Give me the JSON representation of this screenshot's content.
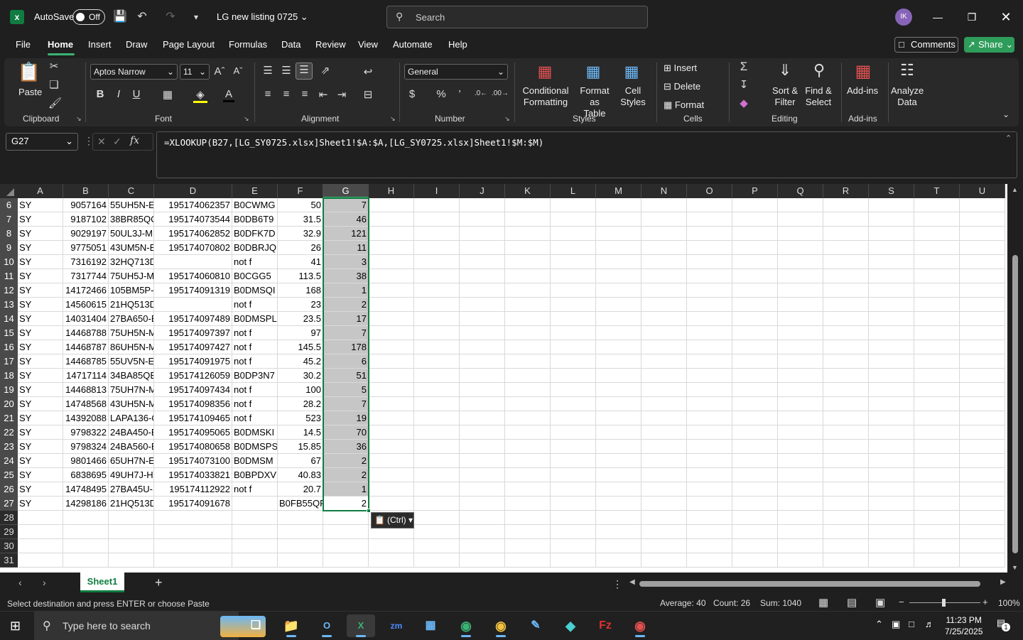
{
  "titlebar": {
    "autosave_label": "AutoSave",
    "autosave_state": "Off",
    "doc_title": "LG new listing 0725",
    "search_placeholder": "Search",
    "avatar_initials": "IK"
  },
  "menu": {
    "items": [
      "File",
      "Home",
      "Insert",
      "Draw",
      "Page Layout",
      "Formulas",
      "Data",
      "Review",
      "View",
      "Automate",
      "Help"
    ],
    "active": "Home",
    "comments_label": "Comments",
    "share_label": "Share"
  },
  "ribbon": {
    "paste_label": "Paste",
    "clipboard_label": "Clipboard",
    "font_name": "Aptos Narrow",
    "font_size": "11",
    "font_label": "Font",
    "alignment_label": "Alignment",
    "number_format": "General",
    "number_label": "Number",
    "conditional_formatting": [
      "Conditional",
      "Formatting"
    ],
    "format_as_table": [
      "Format as",
      "Table"
    ],
    "cell_styles": [
      "Cell",
      "Styles"
    ],
    "styles_label": "Styles",
    "insert_label": "Insert",
    "delete_label": "Delete",
    "format_label": "Format",
    "cells_label": "Cells",
    "sort_filter": [
      "Sort &",
      "Filter"
    ],
    "find_select": [
      "Find &",
      "Select"
    ],
    "editing_label": "Editing",
    "addins_label": "Add-ins",
    "addins_group_label": "Add-ins",
    "analyze_data": [
      "Analyze",
      "Data"
    ]
  },
  "formula_bar": {
    "name_box": "G27",
    "formula": "=XLOOKUP(B27,[LG_SY0725.xlsx]Sheet1!$A:$A,[LG_SY0725.xlsx]Sheet1!$M:$M)"
  },
  "grid": {
    "columns": [
      "A",
      "B",
      "C",
      "D",
      "E",
      "F",
      "G",
      "H",
      "I",
      "J",
      "K",
      "L",
      "M",
      "N",
      "O",
      "P",
      "Q",
      "R",
      "S",
      "T",
      "U"
    ],
    "selected_column": "G",
    "rows": [
      {
        "n": "6",
        "A": "SY",
        "B": "9057164",
        "C": "55UH5N-E",
        "D": "195174062357",
        "E": "B0CWMG",
        "F": "50",
        "G": "7"
      },
      {
        "n": "7",
        "A": "SY",
        "B": "9187102",
        "C": "38BR85QC",
        "D": "195174073544",
        "E": "B0DB6T9",
        "F": "31.5",
        "G": "46"
      },
      {
        "n": "8",
        "A": "SY",
        "B": "9029197",
        "C": "50UL3J-M",
        "D": "195174062852",
        "E": "B0DFK7D",
        "F": "32.9",
        "G": "121"
      },
      {
        "n": "9",
        "A": "SY",
        "B": "9775051",
        "C": "43UM5N-E",
        "D": "195174070802",
        "E": "B0DBRJQ",
        "F": "26",
        "G": "11"
      },
      {
        "n": "10",
        "A": "SY",
        "B": "7316192",
        "C": "32HQ713D",
        "D": "",
        "E": "not f",
        "F": "41",
        "G": "3"
      },
      {
        "n": "11",
        "A": "SY",
        "B": "7317744",
        "C": "75UH5J-M",
        "D": "195174060810",
        "E": "B0CGG5",
        "F": "113.5",
        "G": "38"
      },
      {
        "n": "12",
        "A": "SY",
        "B": "14172466",
        "C": "105BM5P-",
        "D": "195174091319",
        "E": "B0DMSQI",
        "F": "168",
        "G": "1"
      },
      {
        "n": "13",
        "A": "SY",
        "B": "14560615",
        "C": "21HQ513D",
        "D": "",
        "E": "not f",
        "F": "23",
        "G": "2"
      },
      {
        "n": "14",
        "A": "SY",
        "B": "14031404",
        "C": "27BA650-E",
        "D": "195174097489",
        "E": "B0DMSPL",
        "F": "23.5",
        "G": "17"
      },
      {
        "n": "15",
        "A": "SY",
        "B": "14468788",
        "C": "75UH5N-M",
        "D": "195174097397",
        "E": "not f",
        "F": "97",
        "G": "7"
      },
      {
        "n": "16",
        "A": "SY",
        "B": "14468787",
        "C": "86UH5N-M",
        "D": "195174097427",
        "E": "not f",
        "F": "145.5",
        "G": "178"
      },
      {
        "n": "17",
        "A": "SY",
        "B": "14468785",
        "C": "55UV5N-E",
        "D": "195174091975",
        "E": "not f",
        "F": "45.2",
        "G": "6"
      },
      {
        "n": "18",
        "A": "SY",
        "B": "14717114",
        "C": "34BA85QE",
        "D": "195174126059",
        "E": "B0DP3N7",
        "F": "30.2",
        "G": "51"
      },
      {
        "n": "19",
        "A": "SY",
        "B": "14468813",
        "C": "75UH7N-M",
        "D": "195174097434",
        "E": "not f",
        "F": "100",
        "G": "5"
      },
      {
        "n": "20",
        "A": "SY",
        "B": "14748568",
        "C": "43UH5N-M",
        "D": "195174098356",
        "E": "not f",
        "F": "28.2",
        "G": "7"
      },
      {
        "n": "21",
        "A": "SY",
        "B": "14392088",
        "C": "LAPA136-C",
        "D": "195174109465",
        "E": "not f",
        "F": "523",
        "G": "19"
      },
      {
        "n": "22",
        "A": "SY",
        "B": "9798322",
        "C": "24BA450-E",
        "D": "195174095065",
        "E": "B0DMSKI",
        "F": "14.5",
        "G": "70"
      },
      {
        "n": "23",
        "A": "SY",
        "B": "9798324",
        "C": "24BA560-E",
        "D": "195174080658",
        "E": "B0DMSPS",
        "F": "15.85",
        "G": "36"
      },
      {
        "n": "24",
        "A": "SY",
        "B": "9801466",
        "C": "65UH7N-E",
        "D": "195174073100",
        "E": "B0DMSM",
        "F": "67",
        "G": "2"
      },
      {
        "n": "25",
        "A": "SY",
        "B": "6838695",
        "C": "49UH7J-H",
        "D": "195174033821",
        "E": "B0BPDXV",
        "F": "40.83",
        "G": "2"
      },
      {
        "n": "26",
        "A": "SY",
        "B": "14748495",
        "C": "27BA45U-E",
        "D": "195174112922",
        "E": "not f",
        "F": "20.7",
        "G": "1"
      },
      {
        "n": "27",
        "A": "SY",
        "B": "14298186",
        "C": "21HQ513D",
        "D": "195174091678",
        "E": "",
        "F": "B0FB55QF",
        "G": "2"
      },
      {
        "n": "28",
        "A": "",
        "B": "",
        "C": "",
        "D": "",
        "E": "",
        "F": "",
        "G": ""
      },
      {
        "n": "29",
        "A": "",
        "B": "",
        "C": "",
        "D": "",
        "E": "",
        "F": "",
        "G": ""
      },
      {
        "n": "30",
        "A": "",
        "B": "",
        "C": "",
        "D": "",
        "E": "",
        "F": "",
        "G": ""
      },
      {
        "n": "31",
        "A": "",
        "B": "",
        "C": "",
        "D": "",
        "E": "",
        "F": "",
        "G": ""
      }
    ],
    "paste_tag": "(Ctrl)"
  },
  "sheet_tabs": {
    "sheets": [
      "Sheet1"
    ]
  },
  "statusbar": {
    "message": "Select destination and press ENTER or choose Paste",
    "average": "Average: 40",
    "count": "Count: 26",
    "sum": "Sum: 1040",
    "zoom": "100%"
  },
  "taskbar": {
    "search_placeholder": "Type here to search",
    "time": "11:23 PM",
    "date": "7/25/2025",
    "notification_count": "1"
  },
  "colors": {
    "accent_green": "#107c41",
    "share_green": "#2e9c5a",
    "avatar_purple": "#8764b8"
  }
}
